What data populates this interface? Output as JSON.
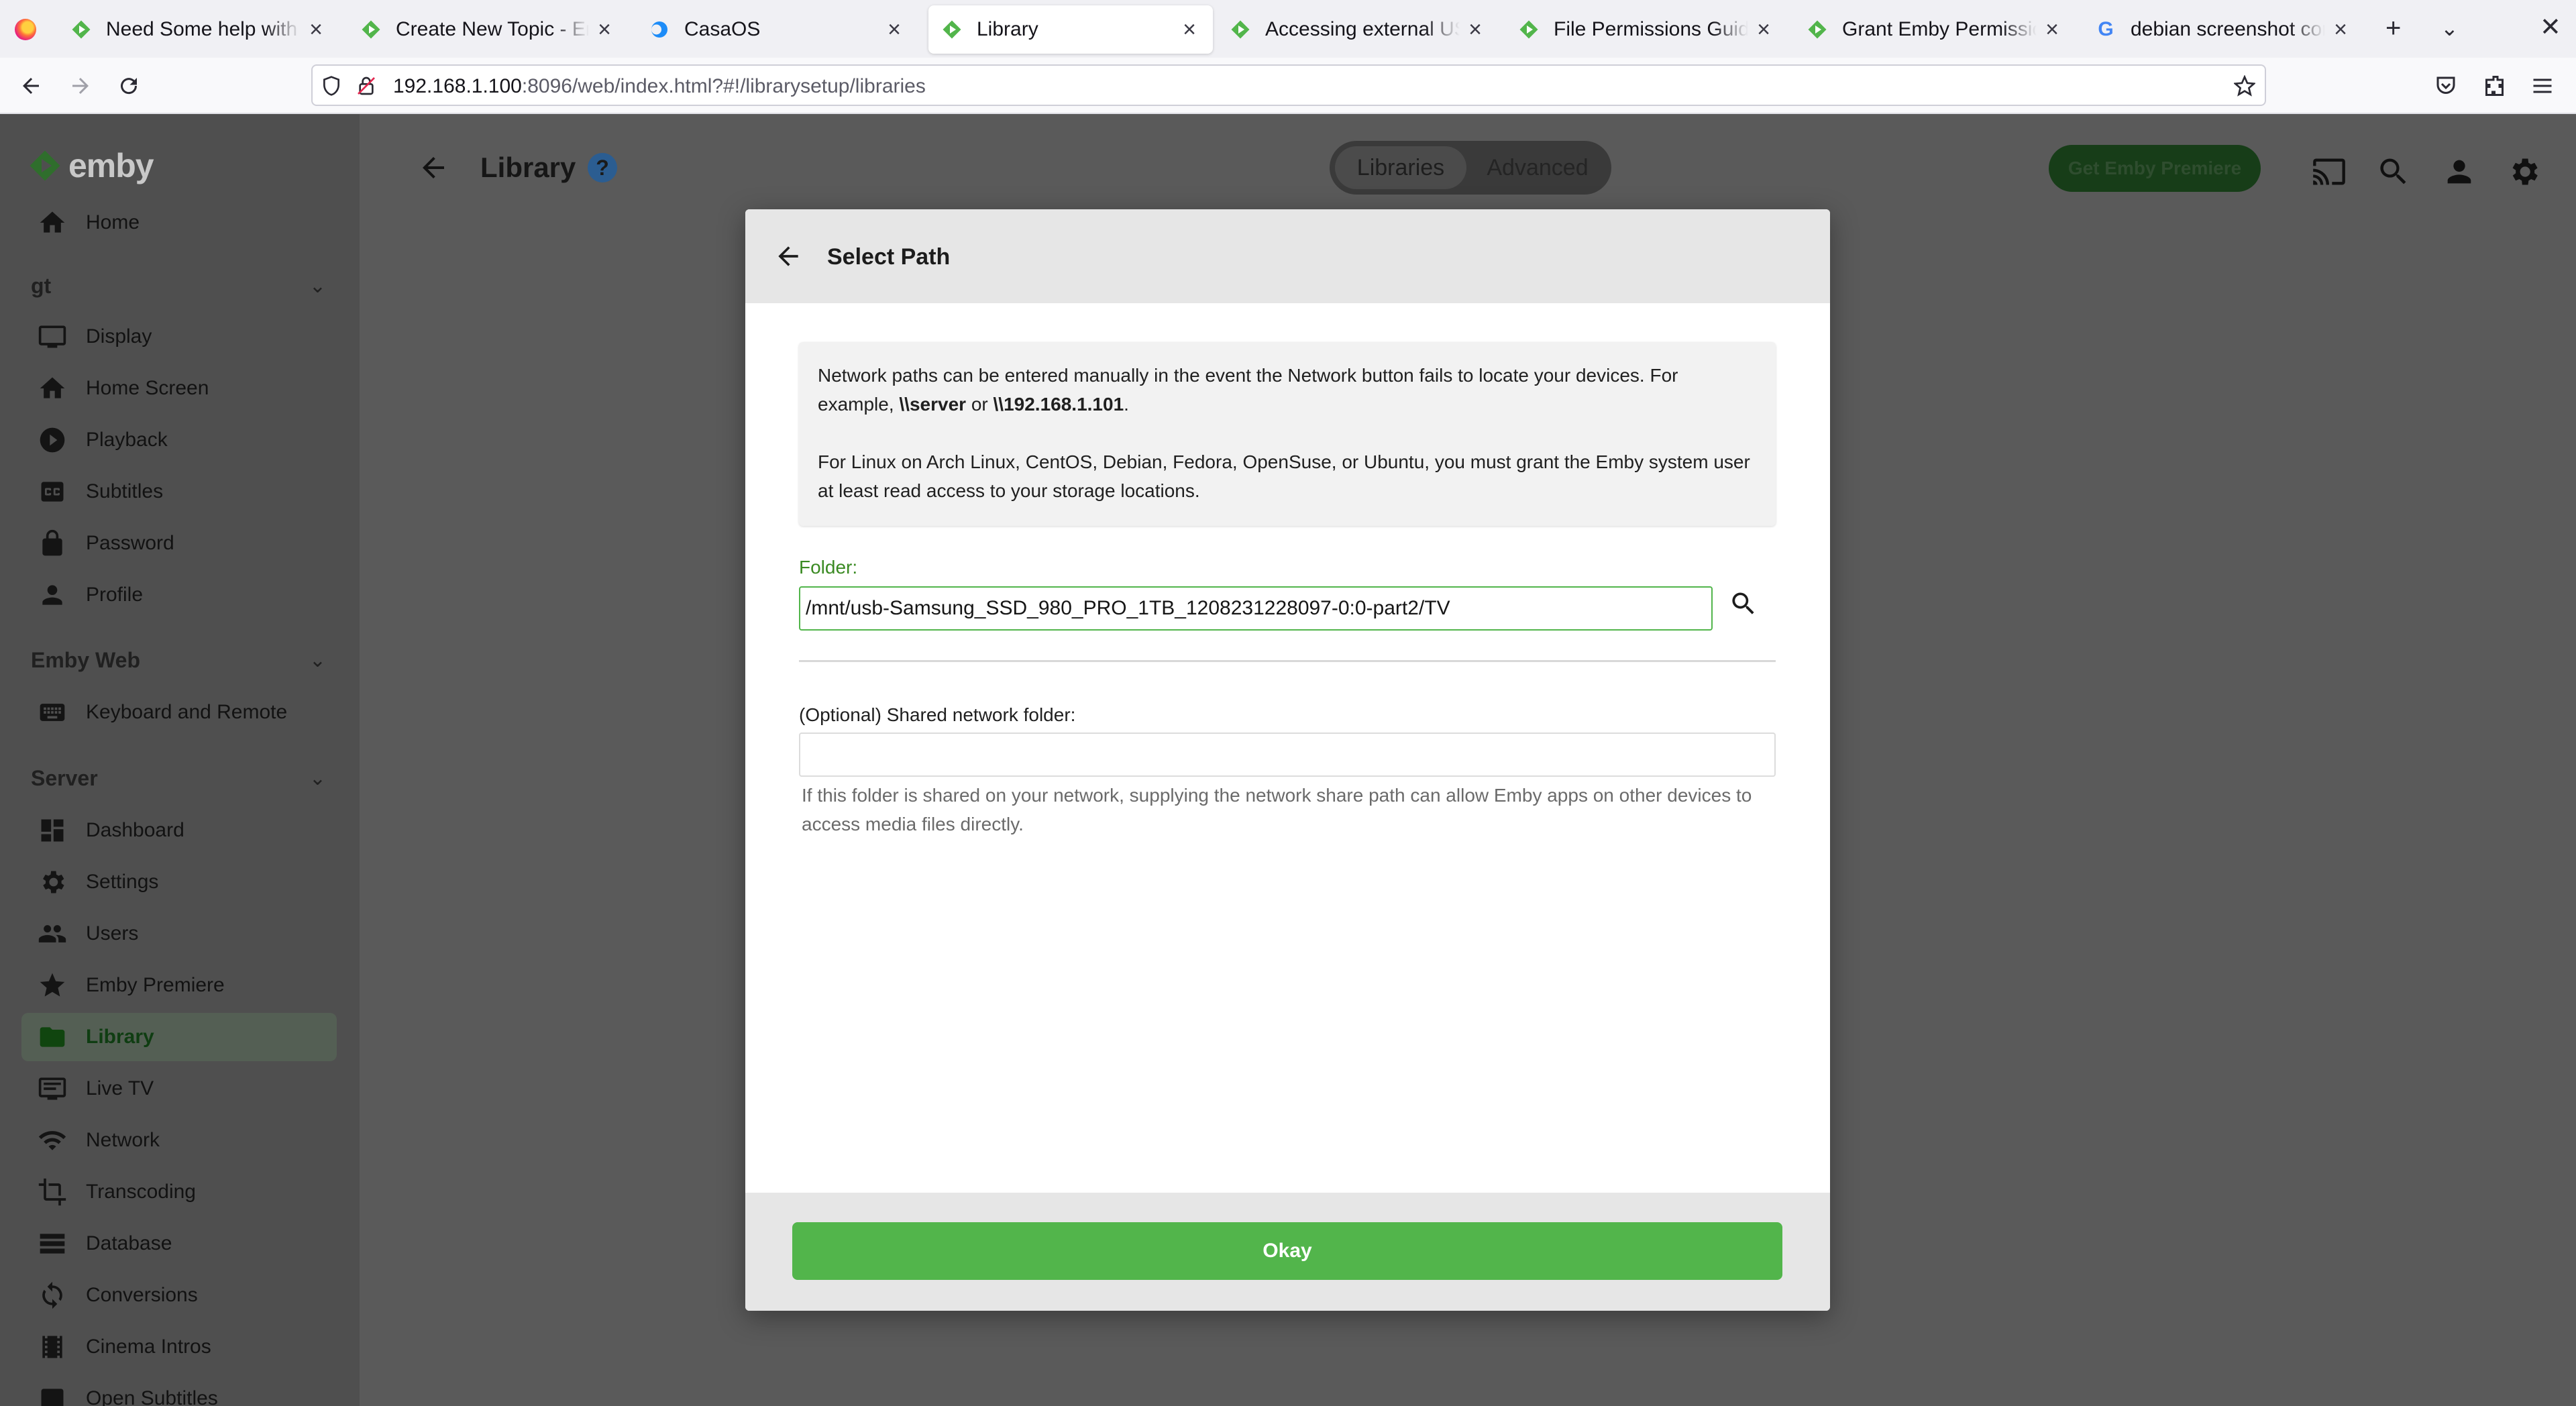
{
  "browser": {
    "tabs": [
      {
        "title": "Need Some help with emby",
        "favicon": "emby-favicon",
        "active": false
      },
      {
        "title": "Create New Topic - Emby",
        "favicon": "emby-favicon",
        "active": false
      },
      {
        "title": "CasaOS",
        "favicon": "casaos-favicon",
        "active": false
      },
      {
        "title": "Library",
        "favicon": "emby-favicon",
        "active": true
      },
      {
        "title": "Accessing external USB drive",
        "favicon": "emby-favicon",
        "active": false
      },
      {
        "title": "File Permissions Guide for",
        "favicon": "emby-favicon",
        "active": false
      },
      {
        "title": "Grant Emby Permissions",
        "favicon": "emby-favicon",
        "active": false
      },
      {
        "title": "debian screenshot command",
        "favicon": "google-favicon",
        "active": false
      }
    ],
    "url": {
      "host": "192.168.1.100",
      "rest": ":8096/web/index.html?#!/librarysetup/libraries"
    }
  },
  "app": {
    "logo_text": "emby",
    "page_title": "Library",
    "help_glyph": "?",
    "header_tabs": [
      "Libraries",
      "Advanced"
    ],
    "premiere_button": "Get Emby Premiere",
    "sidebar": {
      "home": "Home",
      "sections": [
        {
          "title": "gt",
          "items": [
            "Display",
            "Home Screen",
            "Playback",
            "Subtitles",
            "Password",
            "Profile"
          ]
        },
        {
          "title": "Emby Web",
          "items": [
            "Keyboard and Remote"
          ]
        },
        {
          "title": "Server",
          "items": [
            "Dashboard",
            "Settings",
            "Users",
            "Emby Premiere",
            "Library",
            "Live TV",
            "Network",
            "Transcoding",
            "Database",
            "Conversions",
            "Cinema Intros",
            "Open Subtitles"
          ]
        }
      ],
      "active_item": "Library"
    }
  },
  "dialog": {
    "title": "Select Path",
    "info": {
      "line1_start": "Network paths can be entered manually in the event the Network button fails to locate your devices. For example, ",
      "example1": "\\\\server",
      "or": " or ",
      "example2": "\\\\192.168.1.101",
      "line1_end": ".",
      "line2": "For Linux on Arch Linux, CentOS, Debian, Fedora, OpenSuse, or Ubuntu, you must grant the Emby system user at least read access to your storage locations."
    },
    "folder_label": "Folder:",
    "folder_value": "/mnt/usb-Samsung_SSD_980_PRO_1TB_1208231228097-0:0-part2/TV",
    "shared_label": "(Optional) Shared network folder:",
    "shared_value": "",
    "shared_help": "If this folder is shared on your network, supplying the network share path can allow Emby apps on other devices to access media files directly.",
    "okay_button": "Okay"
  },
  "colors": {
    "accent": "#52b54b",
    "overlay_bg": "#5a5a5a",
    "sidebar_bg": "#4f4f4f"
  }
}
